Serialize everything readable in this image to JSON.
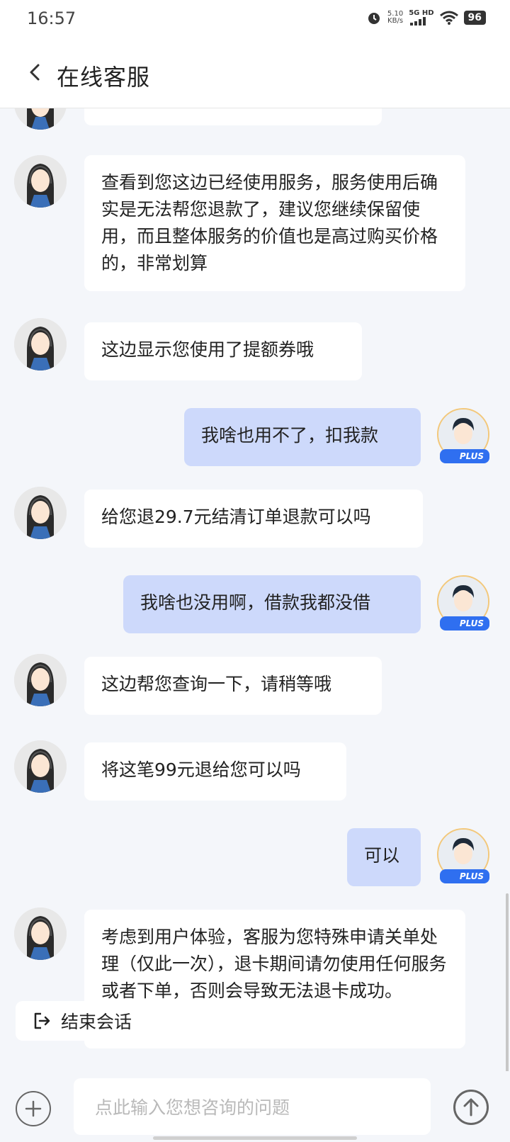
{
  "status_bar": {
    "time": "16:57",
    "net_speed_value": "5.10",
    "net_speed_unit": "KB/s",
    "signal": "5G HD",
    "battery": "96"
  },
  "header": {
    "title": "在线客服"
  },
  "messages": [
    {
      "sender": "agent",
      "text": ""
    },
    {
      "sender": "agent",
      "text": "查看到您这边已经使用服务，服务使用后确实是无法帮您退款了，建议您继续保留使用，而且整体服务的价值也是高过购买价格的，非常划算"
    },
    {
      "sender": "agent",
      "text": "这边显示您使用了提额券哦"
    },
    {
      "sender": "user",
      "text": "我啥也用不了，扣我款"
    },
    {
      "sender": "agent",
      "text": "给您退29.7元结清订单退款可以吗"
    },
    {
      "sender": "user",
      "text": "我啥也没用啊，借款我都没借"
    },
    {
      "sender": "agent",
      "text": "这边帮您查询一下，请稍等哦"
    },
    {
      "sender": "agent",
      "text": "将这笔99元退给您可以吗"
    },
    {
      "sender": "user",
      "text": "可以"
    },
    {
      "sender": "agent",
      "text": "考虑到用户体验，客服为您特殊申请关单处理（仅此一次），退卡期间请勿使用任何服务或者下单，否则会导致无法退卡成功。"
    }
  ],
  "user_badge": "PLUS",
  "end_session": {
    "label": "结束会话"
  },
  "input": {
    "placeholder": "点此输入您想咨询的问题"
  }
}
